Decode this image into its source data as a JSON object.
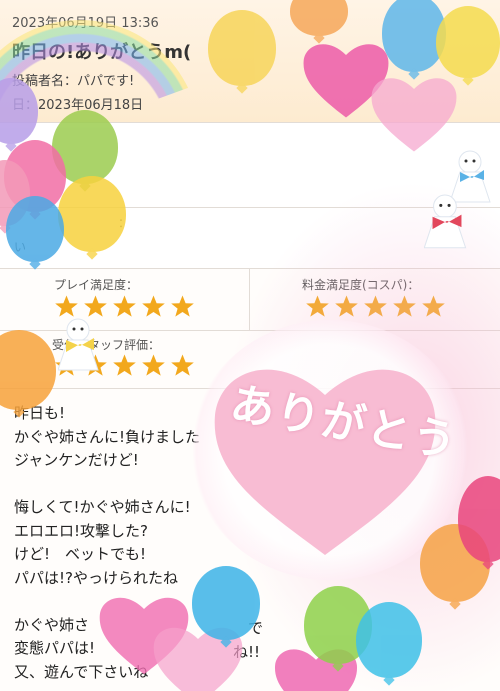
{
  "header": {
    "date": "2023年06月19日 13:36",
    "title": "昨日の!ありがとう",
    "title_trailing": "m(",
    "poster_label": "投稿者名：パパです!",
    "playdate_label": "日：2023年06月18日"
  },
  "blank_row_label": "：",
  "blank_row_value": "い",
  "ratings": {
    "play_label": "プレイ満足度：",
    "play_stars": 5,
    "price_label": "料金満足度(コスパ)：",
    "price_stars": 5,
    "staff_label": "受付スタッフ評価：",
    "staff_stars": 5
  },
  "message": {
    "lines": [
      "昨日も!",
      "かぐや姉さんに!負けました",
      "ジャンケンだけど!",
      "",
      "悔しくて!かぐや姉さんに!",
      "エロエロ!攻撃した?",
      "けど!　ベットでも!",
      "パパは!?やっけられたね",
      "",
      "かぐや姉さ",
      "変態パパは!",
      "又、遊んで下さいね"
    ],
    "fragment_a": "で",
    "fragment_b": "ね!!"
  },
  "stamp_text": "ありがとう",
  "colors": {
    "star": "#f2a81d",
    "header_bg": "#fdebd0",
    "stamp_heart": "#f7b6cf"
  }
}
